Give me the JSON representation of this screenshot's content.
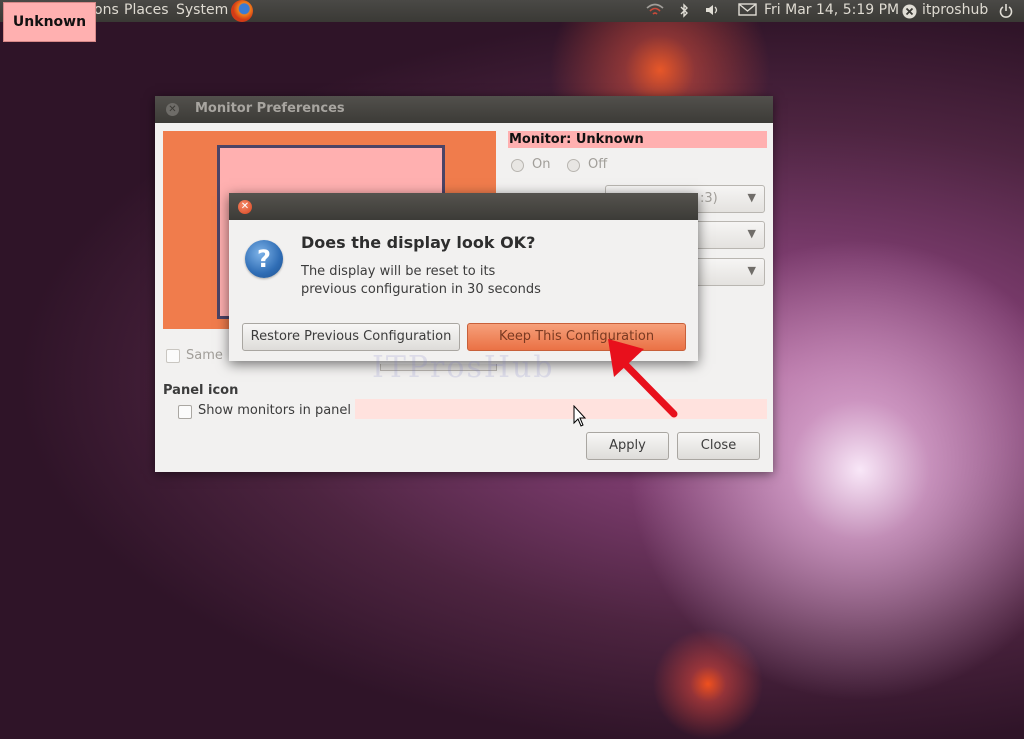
{
  "topbar": {
    "tag": "Unknown",
    "menu": [
      "ons",
      "Places",
      "System"
    ],
    "datetime": "Fri Mar 14,  5:19 PM",
    "user": "itproshub"
  },
  "main_window": {
    "title": "Monitor Preferences",
    "monitor_label": "Monitor: Unknown",
    "on_label": "On",
    "off_label": "Off",
    "combo_value": ":3)",
    "same_image_label": "Same",
    "panel_icon_heading": "Panel icon",
    "show_monitors_label": "Show monitors in panel",
    "apply_label": "Apply",
    "close_label": "Close"
  },
  "dialog": {
    "heading": "Does the display look OK?",
    "message": "The display will be reset to its\nprevious configuration in 30 seconds",
    "restore_label": "Restore Previous Configuration",
    "keep_label": "Keep This Configuration"
  },
  "watermark": "ITProsHub",
  "colors": {
    "highlight_pink": "#ffb0b0",
    "monitor_orange": "#f07c4c",
    "annotation_red": "#e8101c"
  }
}
